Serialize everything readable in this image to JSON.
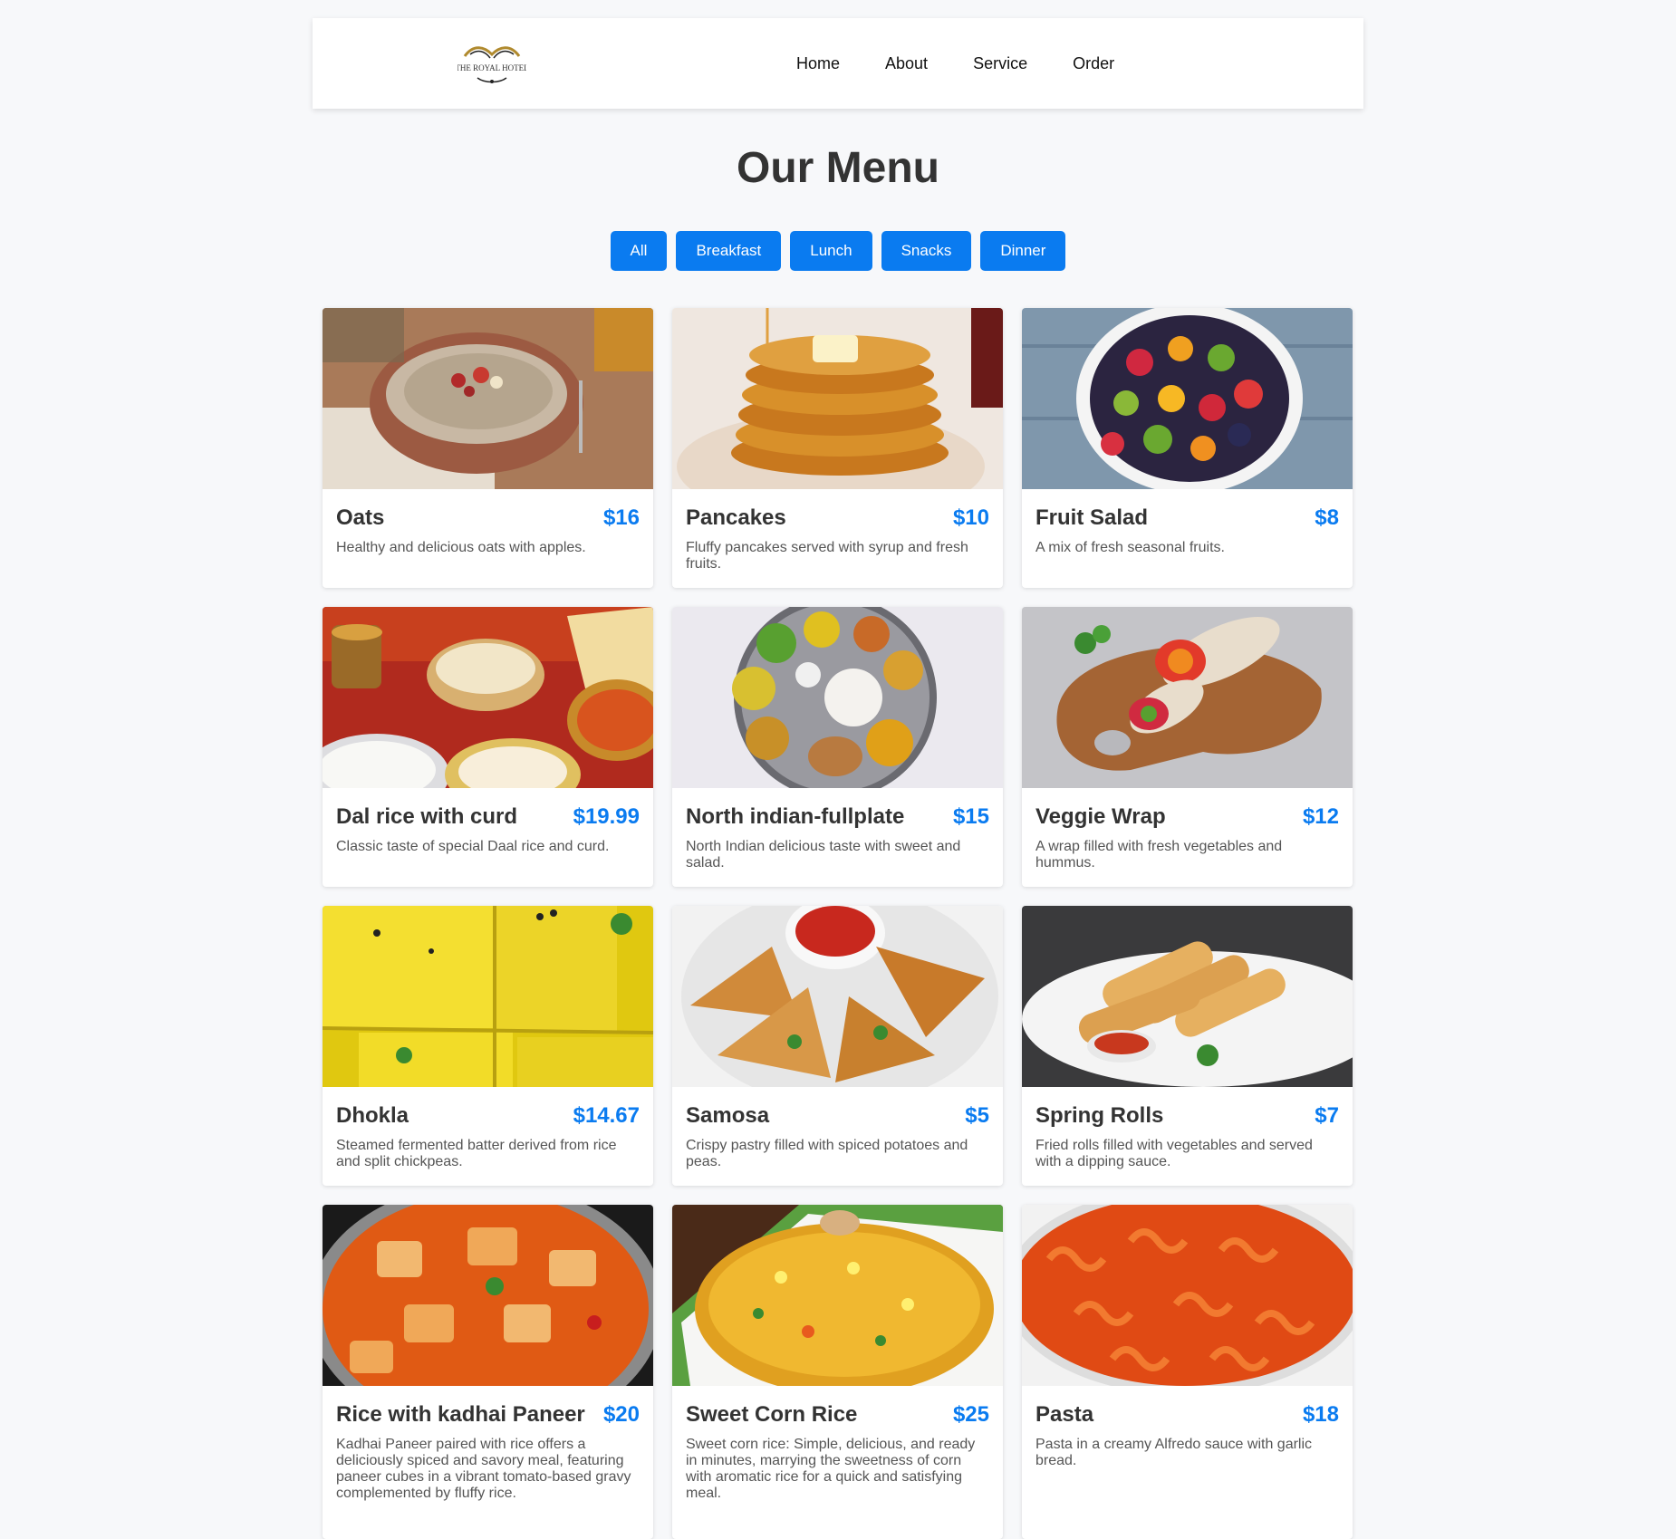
{
  "header": {
    "logo_text": "THE ROYAL HOTEL",
    "nav": [
      "Home",
      "About",
      "Service",
      "Order"
    ]
  },
  "title": "Our Menu",
  "filters": [
    "All",
    "Breakfast",
    "Lunch",
    "Snacks",
    "Dinner"
  ],
  "colors": {
    "accent": "#0a7bf0",
    "background": "#f7f8fa"
  },
  "items": [
    {
      "name": "Oats",
      "price": "$16",
      "desc": "Healthy and delicious oats with apples.",
      "image": "oats bowl"
    },
    {
      "name": "Pancakes",
      "price": "$10",
      "desc": "Fluffy pancakes served with syrup and fresh fruits.",
      "image": "pancake stack"
    },
    {
      "name": "Fruit Salad",
      "price": "$8",
      "desc": "A mix of fresh seasonal fruits.",
      "image": "fruit bowl"
    },
    {
      "name": "Dal rice with curd",
      "price": "$19.99",
      "desc": "Classic taste of special Daal rice and curd.",
      "image": "indian feast"
    },
    {
      "name": "North indian-fullplate",
      "price": "$15",
      "desc": "North Indian delicious taste with sweet and salad.",
      "image": "thali plate"
    },
    {
      "name": "Veggie Wrap",
      "price": "$12",
      "desc": "A wrap filled with fresh vegetables and hummus.",
      "image": "wrap on board"
    },
    {
      "name": "Dhokla",
      "price": "$14.67",
      "desc": "Steamed fermented batter derived from rice and split chickpeas.",
      "image": "dhokla squares"
    },
    {
      "name": "Samosa",
      "price": "$5",
      "desc": "Crispy pastry filled with spiced potatoes and peas.",
      "image": "samosa plate"
    },
    {
      "name": "Spring Rolls",
      "price": "$7",
      "desc": "Fried rolls filled with vegetables and served with a dipping sauce.",
      "image": "spring rolls"
    },
    {
      "name": "Rice with kadhai Paneer",
      "price": "$20",
      "desc": "Kadhai Paneer paired with rice offers a deliciously spiced and savory meal, featuring paneer cubes in a vibrant tomato-based gravy complemented by fluffy rice.",
      "image": "paneer curry"
    },
    {
      "name": "Sweet Corn Rice",
      "price": "$25",
      "desc": "Sweet corn rice: Simple, delicious, and ready in minutes, marrying the sweetness of corn with aromatic rice for a quick and satisfying meal.",
      "image": "corn rice"
    },
    {
      "name": "Pasta",
      "price": "$18",
      "desc": "Pasta in a creamy Alfredo sauce with garlic bread.",
      "image": "fusilli pasta"
    }
  ]
}
